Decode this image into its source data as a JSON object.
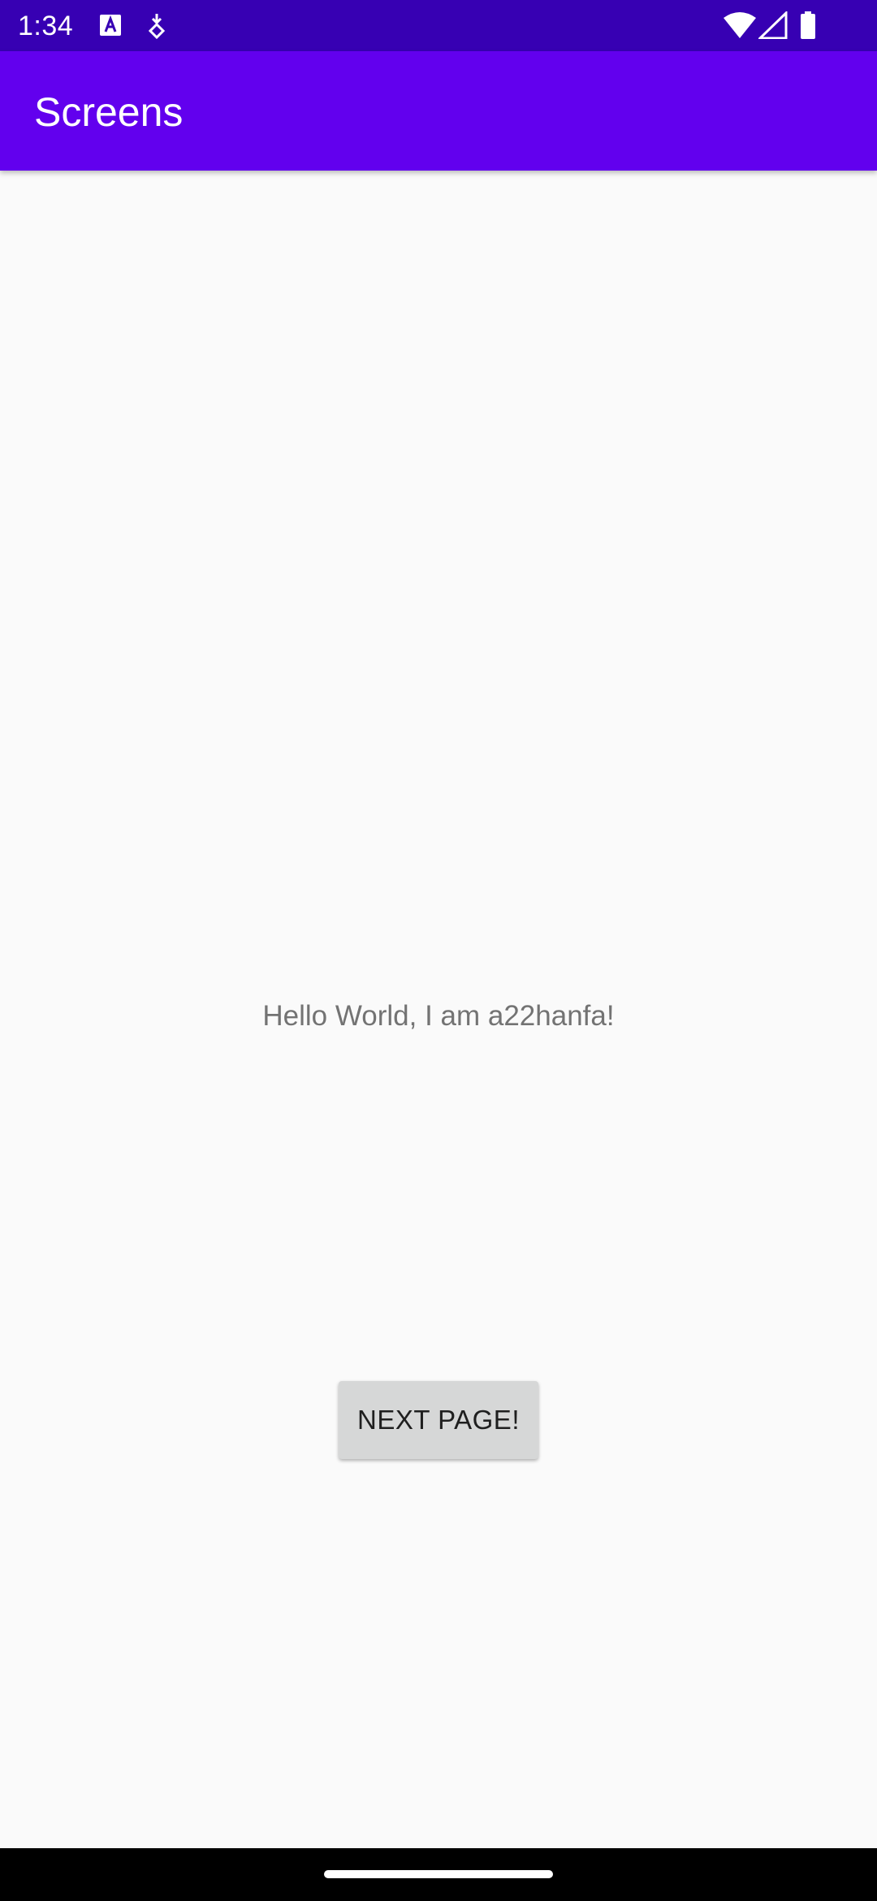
{
  "status_bar": {
    "time": "1:34",
    "icons": [
      "text-icon",
      "download-icon",
      "wifi-icon",
      "signal-icon",
      "battery-icon"
    ],
    "background": "#3700b3"
  },
  "app_bar": {
    "title": "Screens",
    "background": "#6200ee"
  },
  "main": {
    "message": "Hello World, I am a22hanfa!",
    "next_button_label": "NEXT PAGE!"
  },
  "nav_bar": {
    "icons": [
      "home-handle"
    ]
  }
}
